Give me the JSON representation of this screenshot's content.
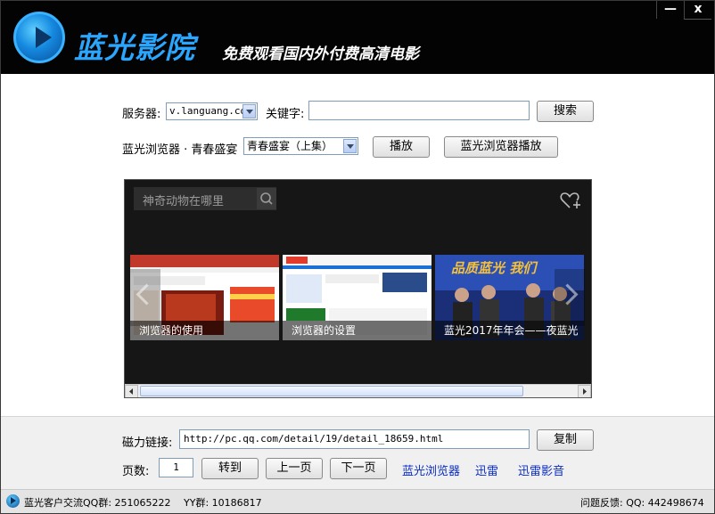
{
  "header": {
    "app_title": "蓝光影院",
    "slogan": "免费观看国内外付费高清电影",
    "minimize_label": "—",
    "close_label": "x"
  },
  "form": {
    "server_label": "服务器:",
    "server_value": "v.languang.com",
    "keyword_label": "关键字:",
    "keyword_value": "",
    "search_label": "搜索",
    "episode_prefix": "蓝光浏览器 · 青春盛宴",
    "episode_value": "青春盛宴（上集）",
    "play_label": "播放",
    "browser_play_label": "蓝光浏览器播放"
  },
  "browser": {
    "search_placeholder": "神奇动物在哪里",
    "cards": [
      {
        "caption": "浏览器的使用"
      },
      {
        "caption": "浏览器的设置"
      },
      {
        "caption": "蓝光2017年年会——夜蓝光"
      }
    ],
    "card3_overlay": "品质蓝光  我们"
  },
  "bottom": {
    "magnet_label": "磁力链接:",
    "magnet_value": "http://pc.qq.com/detail/19/detail_18659.html",
    "copy_label": "复制",
    "page_label": "页数:",
    "page_value": "1",
    "goto_label": "转到",
    "prev_label": "上一页",
    "next_label": "下一页",
    "links": [
      "蓝光浏览器",
      "迅雷",
      "迅雷影音"
    ]
  },
  "status": {
    "qq_group": "蓝光客户交流QQ群: 251065222",
    "yy_group": "YY群: 10186817",
    "feedback": "问题反馈: QQ: 442498674"
  },
  "colors": {
    "title_blue": "#2aa6ff",
    "link_blue": "#0a2cc4",
    "header_bg": "#030303"
  },
  "icons": [
    "play-logo-icon",
    "search-icon",
    "heart-plus-icon",
    "chevron-left-icon",
    "chevron-right-icon",
    "dropdown-arrow-icon",
    "status-logo-icon"
  ]
}
